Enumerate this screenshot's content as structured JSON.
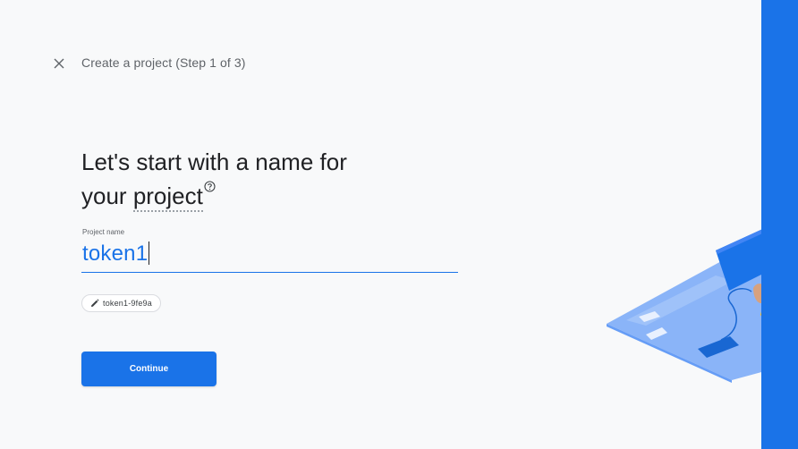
{
  "header": {
    "close_icon": "close-icon",
    "step_title": "Create a project (Step 1 of 3)"
  },
  "headline": {
    "line1": "Let's start with a name for",
    "line2_prefix": "your ",
    "line2_keyword": "project",
    "help_icon": "help-circle-icon"
  },
  "project_name_field": {
    "label": "Project name",
    "value": "token1"
  },
  "project_id_chip": {
    "icon": "pencil-icon",
    "value": "token1-9fe9a"
  },
  "actions": {
    "continue_label": "Continue"
  },
  "colors": {
    "accent": "#1a73e8",
    "background": "#f8f9fa",
    "text_primary": "#202124",
    "text_secondary": "#5f6368"
  }
}
